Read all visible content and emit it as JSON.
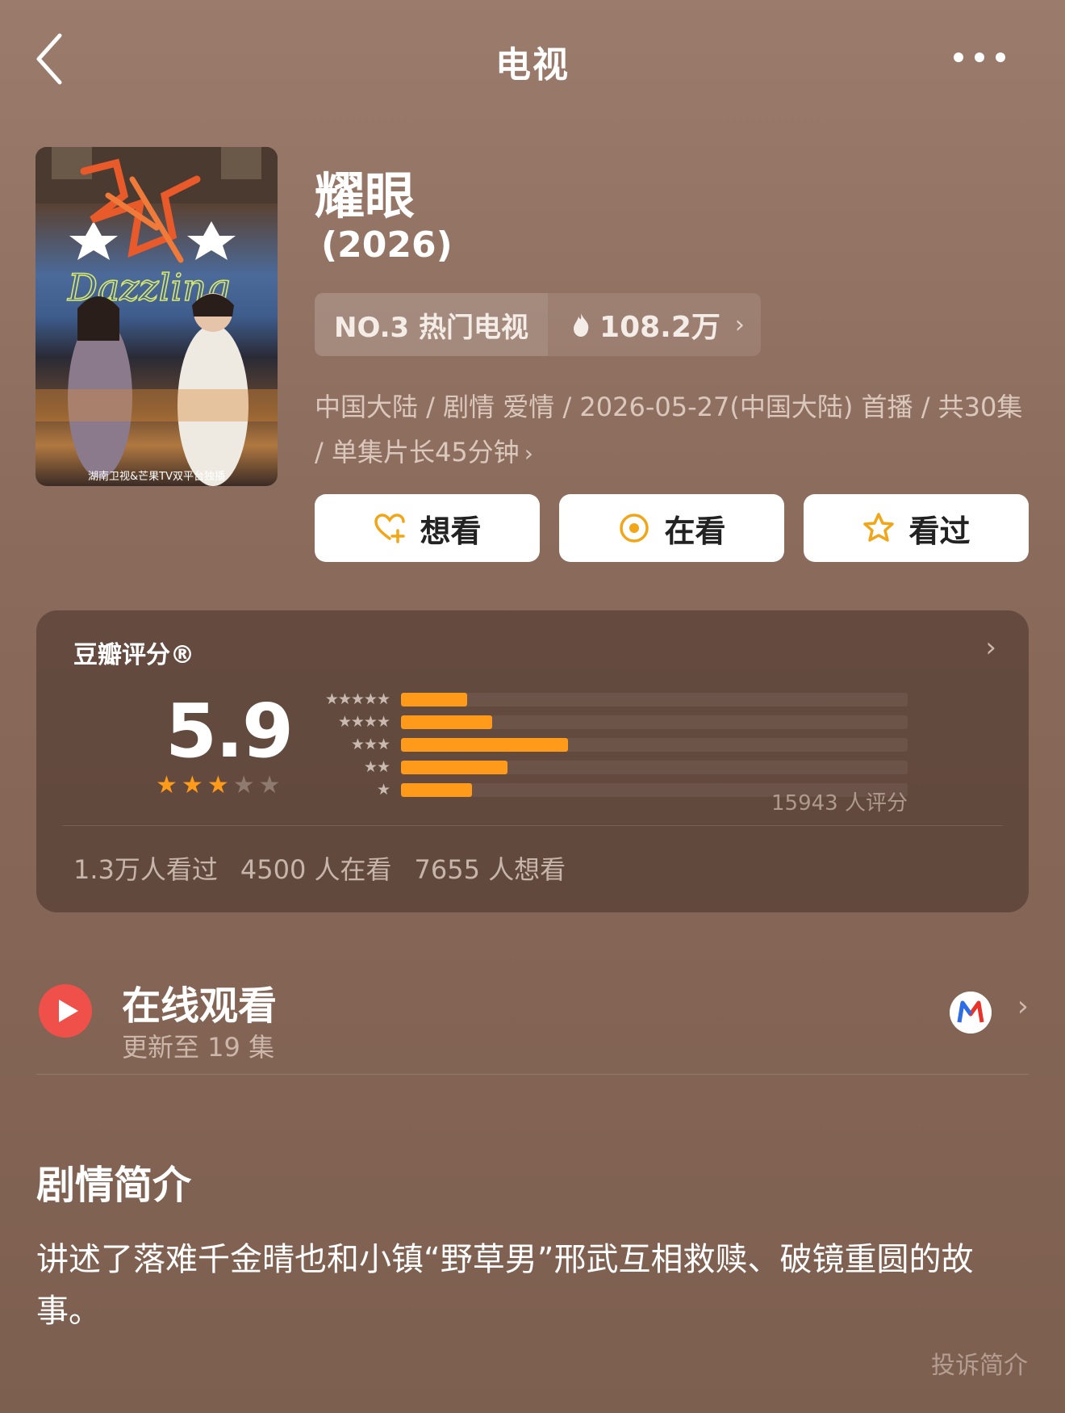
{
  "header": {
    "title": "电视",
    "back_icon": "chevron-left-icon",
    "more_icon": "more-dots-icon"
  },
  "show": {
    "title": "耀眼",
    "year": "(2026)",
    "rank_label": "NO.3 热门电视",
    "heat_value": "108.2万",
    "meta_text": "中国大陆 / 剧情 爱情 / 2026-05-27(中国大陆) 首播 / 共30集 / 单集片长45分钟",
    "poster_en_title": "Dazzling",
    "poster_caption": "湖南卫视&芒果TV双平台独播"
  },
  "actions": {
    "want": "想看",
    "watching": "在看",
    "watched": "看过"
  },
  "rating": {
    "title": "豆瓣评分®",
    "score": "5.9",
    "stars_filled": 3,
    "stars_total": 5,
    "raters": "15943 人评分",
    "distribution": [
      {
        "stars": "★★★★★",
        "fraction": 0.13
      },
      {
        "stars": "★★★★",
        "fraction": 0.18
      },
      {
        "stars": "★★★",
        "fraction": 0.33
      },
      {
        "stars": "★★",
        "fraction": 0.21
      },
      {
        "stars": "★",
        "fraction": 0.14
      }
    ],
    "watched_count": "1.3万人看过",
    "watching_count": "4500 人在看",
    "want_count": "7655 人想看"
  },
  "watch": {
    "title": "在线观看",
    "subtitle": "更新至 19 集"
  },
  "synopsis": {
    "title": "剧情简介",
    "body": "讲述了落难千金晴也和小镇“野草男”邢武互相救赎、破镜重圆的故事。",
    "report": "投诉简介"
  },
  "colors": {
    "accent": "#ff9a1a",
    "play_red": "#f0504a",
    "star_empty": "#8f7a70"
  }
}
